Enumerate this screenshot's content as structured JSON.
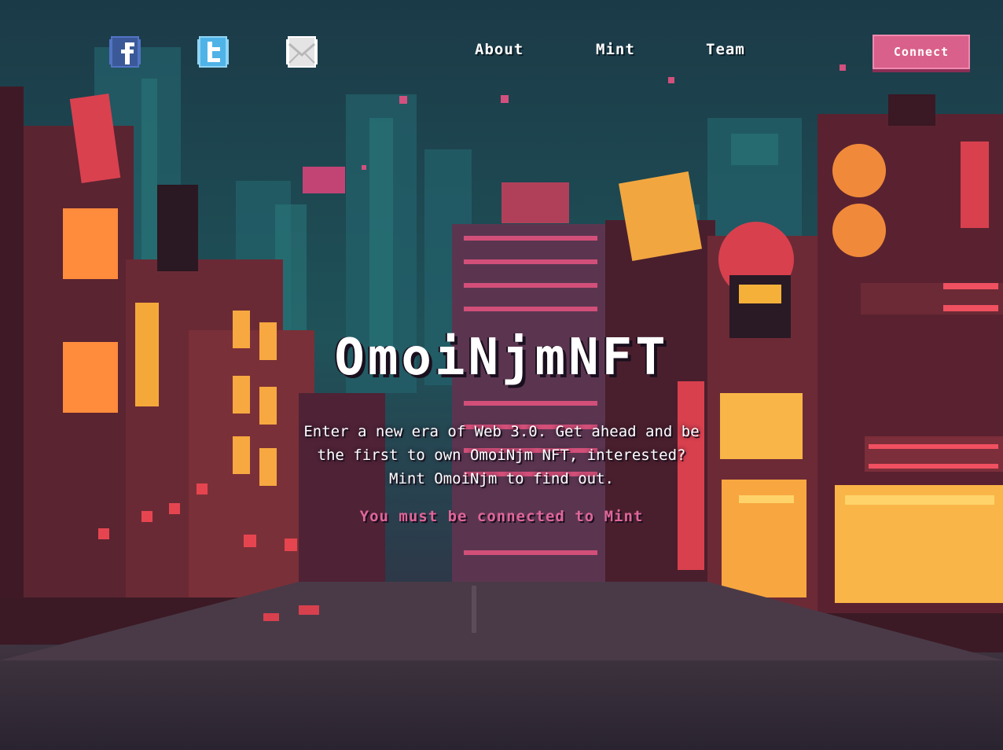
{
  "nav": {
    "social": [
      {
        "icon": "facebook-icon",
        "color": "#3b5998"
      },
      {
        "icon": "twitter-icon",
        "color": "#4fb3e8"
      },
      {
        "icon": "mail-icon",
        "color": "#e8e8e8"
      }
    ],
    "links": [
      "About",
      "Mint",
      "Team"
    ],
    "connect_label": "Connect"
  },
  "hero": {
    "title": "OmoiNjmNFT",
    "description": "Enter a new era of Web 3.0. Get ahead and be the first to own OmoiNjm NFT, interested? Mint OmoiNjm to find out.",
    "status": "You must be connected to Mint"
  },
  "colors": {
    "accent": "#d9608a",
    "status_text": "#e0669a",
    "sky": "#1d3c4a",
    "street": "#3a3038"
  }
}
